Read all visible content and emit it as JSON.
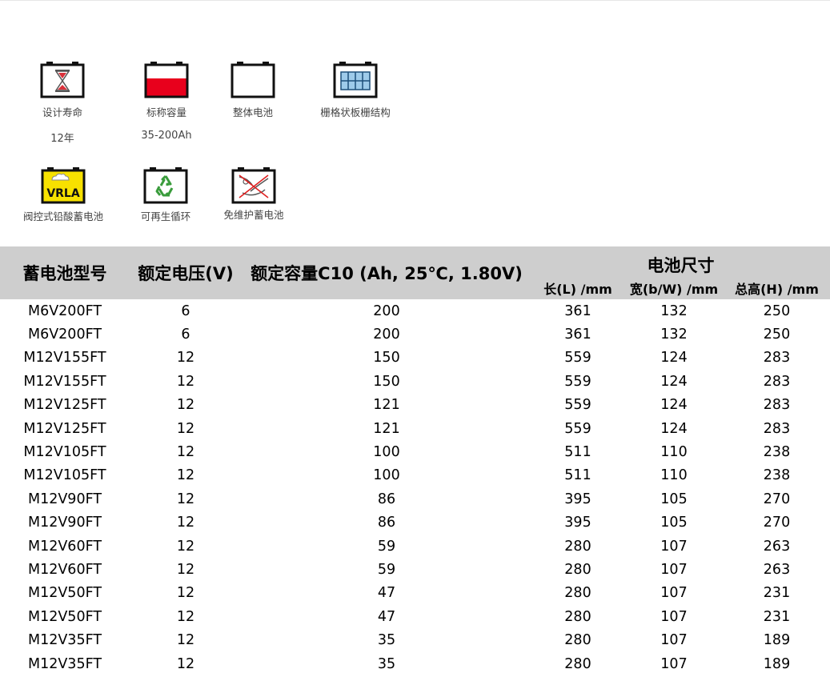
{
  "features": [
    {
      "id": "design-life",
      "icon": "hourglass-battery-icon",
      "label": "设计寿命",
      "value": "12年"
    },
    {
      "id": "capacity",
      "icon": "charged-battery-icon",
      "label": "标称容量",
      "value": "35-200Ah"
    },
    {
      "id": "integral",
      "icon": "empty-battery-icon",
      "label": "整体电池"
    },
    {
      "id": "grid",
      "icon": "grid-plate-battery-icon",
      "label": "栅格状板栅结构"
    },
    {
      "id": "vrla",
      "icon": "vrla-battery-icon",
      "icon_text": "VRLA",
      "label": "阀控式铅酸蓄电池"
    },
    {
      "id": "recycle",
      "icon": "recycle-battery-icon",
      "label": "可再生循环"
    },
    {
      "id": "maintenance-free",
      "icon": "no-maintenance-battery-icon",
      "label": "免维护蓄电池"
    }
  ],
  "colors": {
    "header_bg": "#cecece",
    "capacity_fill": "#e8001c",
    "vrla_fill": "#f7e100",
    "recycle_fill": "#3a9c3c",
    "grid_fill": "#9ecbea"
  },
  "table": {
    "headers": {
      "model": "蓄电池型号",
      "voltage": "额定电压(V)",
      "capacity": "额定容量C10 (Ah, 25℃, 1.80V)",
      "dimensions": "电池尺寸",
      "length": "长(L) /mm",
      "width": "宽(b/W) /mm",
      "height": "总高(H) /mm"
    },
    "rows": [
      [
        "M6V200FT",
        "6",
        "200",
        "361",
        "132",
        "250"
      ],
      [
        "M6V200FT",
        "6",
        "200",
        "361",
        "132",
        "250"
      ],
      [
        "M12V155FT",
        "12",
        "150",
        "559",
        "124",
        "283"
      ],
      [
        "M12V155FT",
        "12",
        "150",
        "559",
        "124",
        "283"
      ],
      [
        "M12V125FT",
        "12",
        "121",
        "559",
        "124",
        "283"
      ],
      [
        "M12V125FT",
        "12",
        "121",
        "559",
        "124",
        "283"
      ],
      [
        "M12V105FT",
        "12",
        "100",
        "511",
        "110",
        "238"
      ],
      [
        "M12V105FT",
        "12",
        "100",
        "511",
        "110",
        "238"
      ],
      [
        "M12V90FT",
        "12",
        "86",
        "395",
        "105",
        "270"
      ],
      [
        "M12V90FT",
        "12",
        "86",
        "395",
        "105",
        "270"
      ],
      [
        "M12V60FT",
        "12",
        "59",
        "280",
        "107",
        "263"
      ],
      [
        "M12V60FT",
        "12",
        "59",
        "280",
        "107",
        "263"
      ],
      [
        "M12V50FT",
        "12",
        "47",
        "280",
        "107",
        "231"
      ],
      [
        "M12V50FT",
        "12",
        "47",
        "280",
        "107",
        "231"
      ],
      [
        "M12V35FT",
        "12",
        "35",
        "280",
        "107",
        "189"
      ],
      [
        "M12V35FT",
        "12",
        "35",
        "280",
        "107",
        "189"
      ]
    ]
  }
}
